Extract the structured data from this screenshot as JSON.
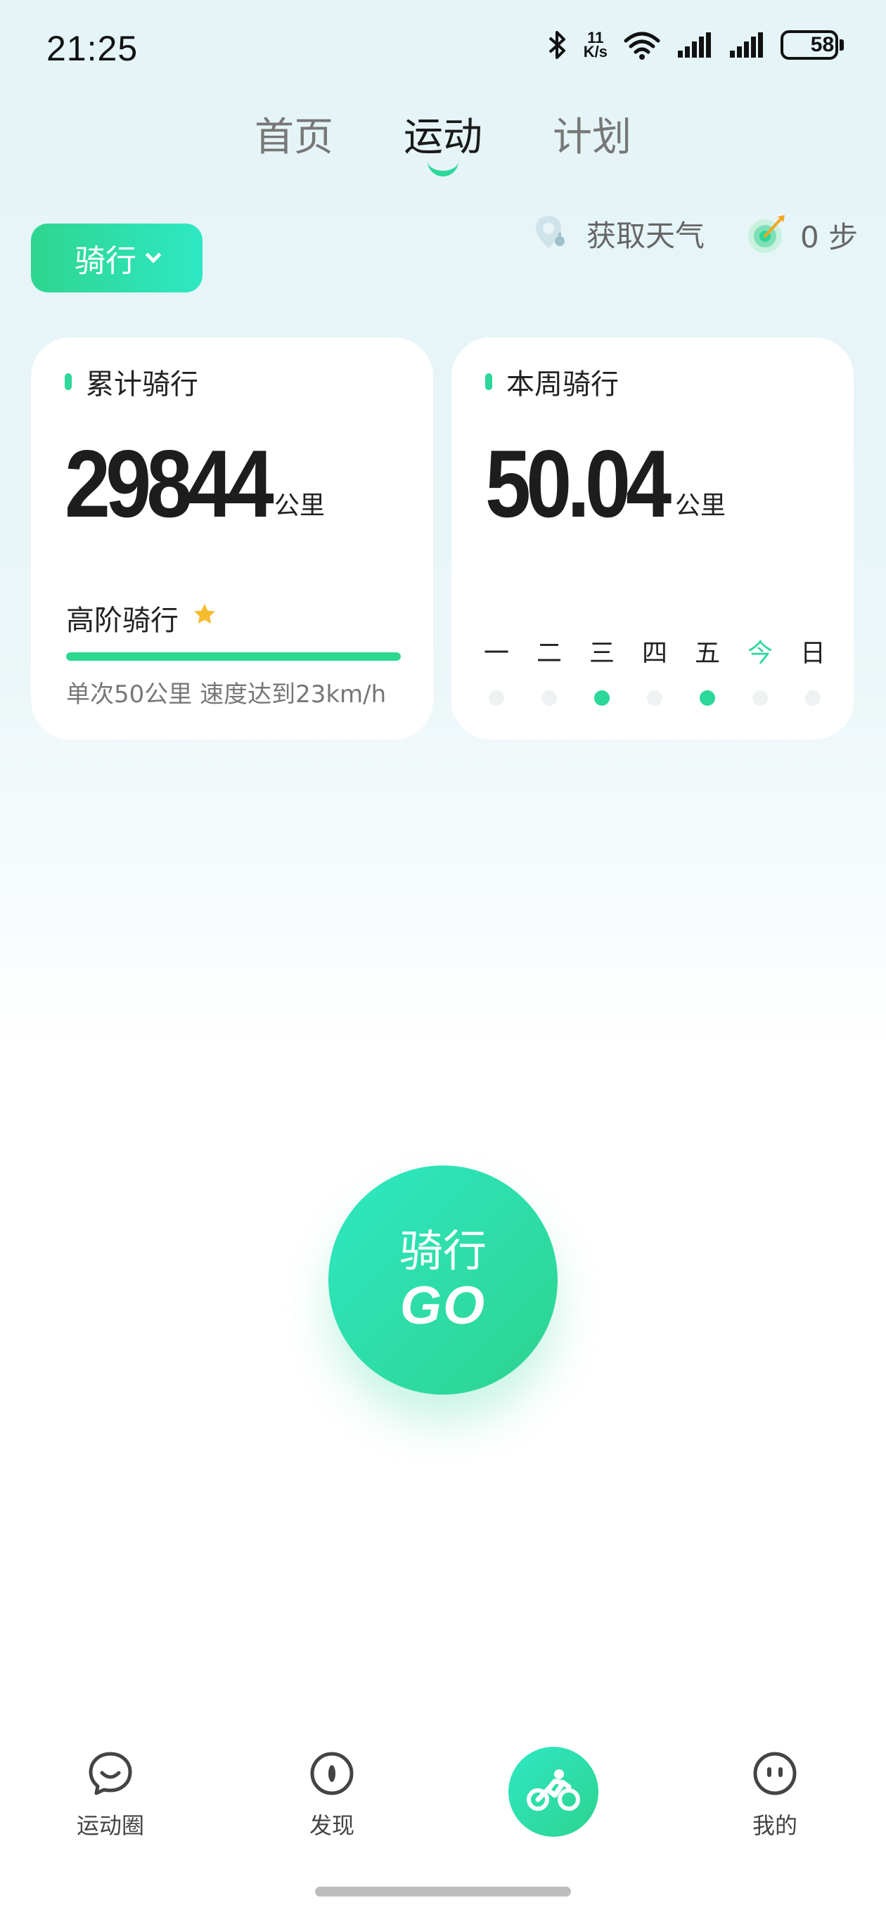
{
  "status_bar": {
    "time": "21:25",
    "net_speed_value": "11",
    "net_speed_unit": "K/s",
    "battery": "58",
    "battery_level_percent": 58
  },
  "top_tabs": [
    {
      "label": "首页",
      "active": false
    },
    {
      "label": "运动",
      "active": true
    },
    {
      "label": "计划",
      "active": false
    }
  ],
  "sport_selector": {
    "label": "骑行"
  },
  "weather": {
    "label": "获取天气"
  },
  "steps": {
    "label": "0 步"
  },
  "total_card": {
    "title": "累计骑行",
    "value": "29844",
    "unit": "公里",
    "level_name": "高阶骑行",
    "level_progress_percent": 100,
    "level_desc": "单次50公里 速度达到23km/h"
  },
  "week_card": {
    "title": "本周骑行",
    "value": "50.04",
    "unit": "公里",
    "days": [
      {
        "label": "一",
        "done": false,
        "today": false
      },
      {
        "label": "二",
        "done": false,
        "today": false
      },
      {
        "label": "三",
        "done": true,
        "today": false
      },
      {
        "label": "四",
        "done": false,
        "today": false
      },
      {
        "label": "五",
        "done": true,
        "today": false
      },
      {
        "label": "今",
        "done": false,
        "today": true
      },
      {
        "label": "日",
        "done": false,
        "today": false
      }
    ]
  },
  "go_button": {
    "line1": "骑行",
    "line2": "GO"
  },
  "bottom_nav": [
    {
      "label": "运动圈",
      "icon": "chat-smile-icon"
    },
    {
      "label": "发现",
      "icon": "compass-icon"
    },
    {
      "label": "",
      "icon": "cyclist-icon"
    },
    {
      "label": "我的",
      "icon": "face-icon"
    }
  ],
  "colors": {
    "accent": "#2cd79a",
    "accent_light": "#2ee8c4",
    "star": "#f6bb2e"
  }
}
